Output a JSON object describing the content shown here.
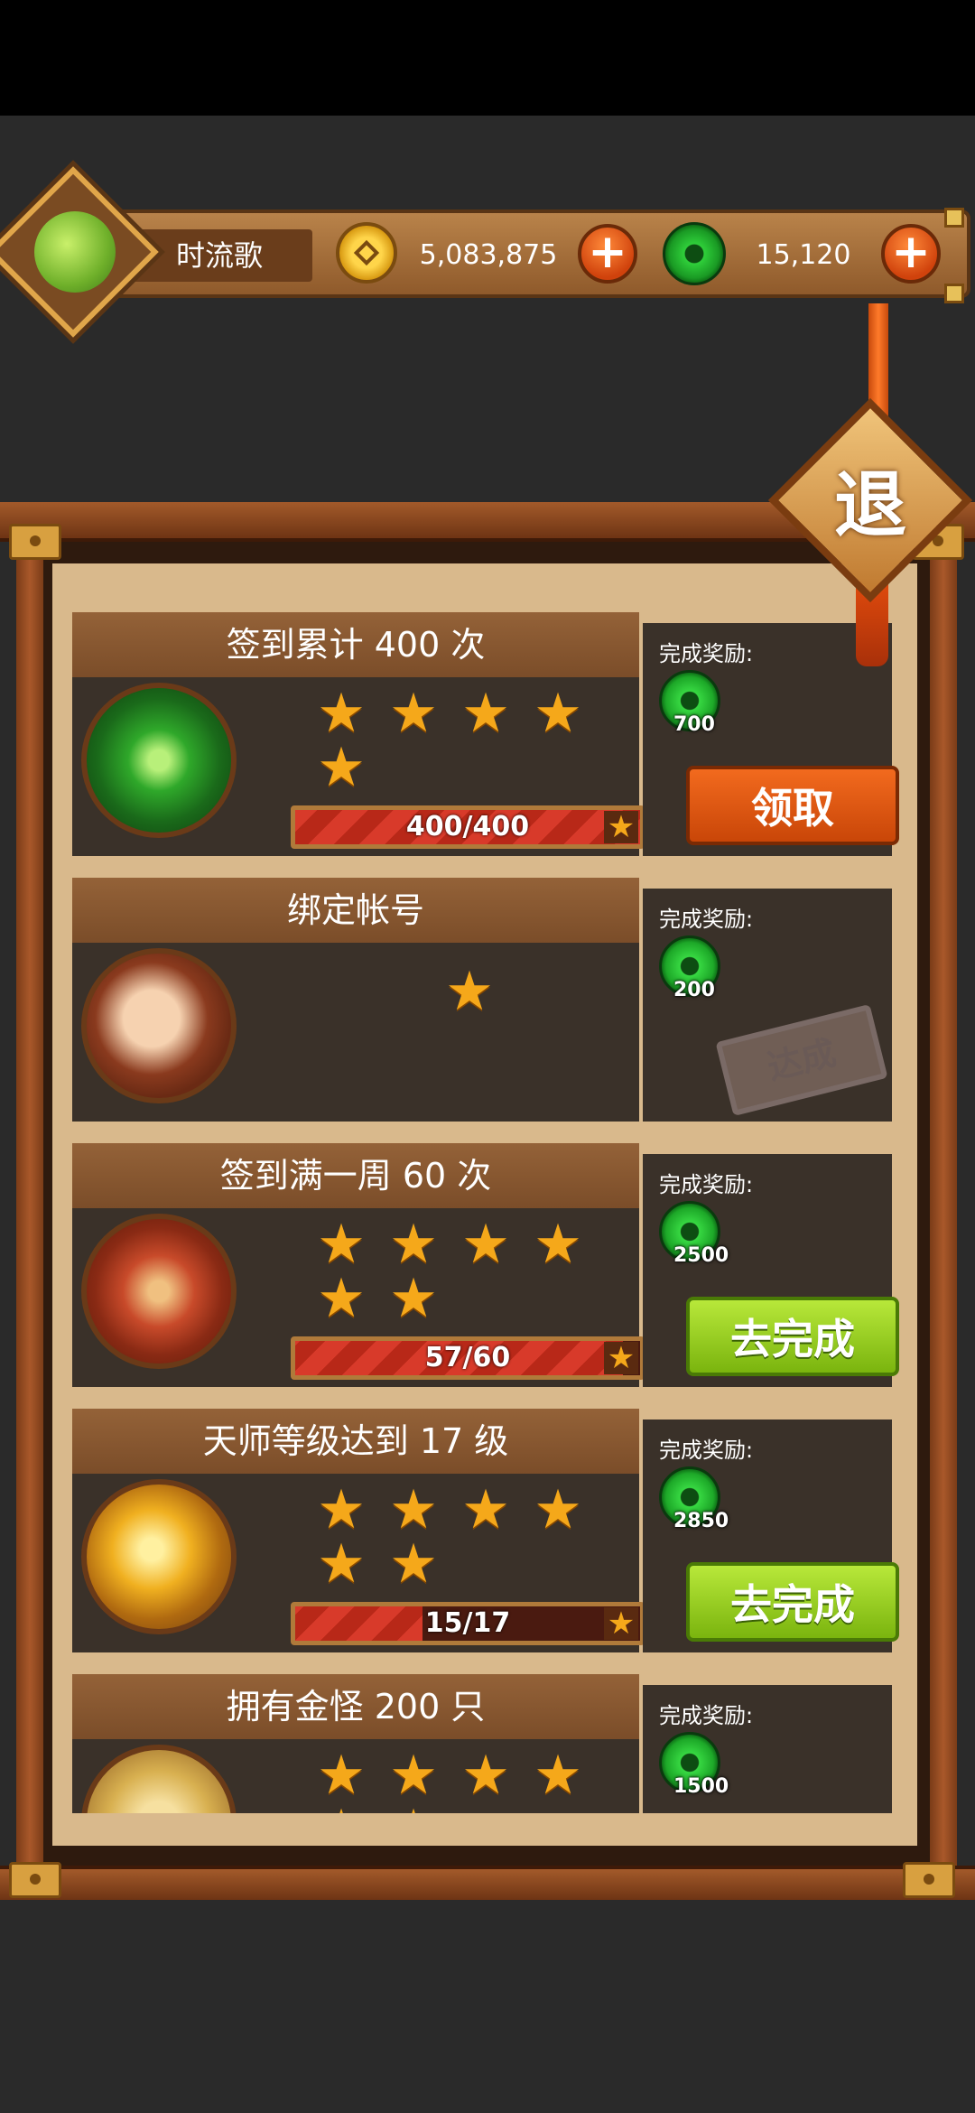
{
  "header": {
    "player_name": "时流歌",
    "coins": "5,083,875",
    "jade": "15,120",
    "plus_symbol": "+"
  },
  "exit_label": "退",
  "reward_label": "完成奖励:",
  "tasks": [
    {
      "title": "签到累计 400 次",
      "reward": "700",
      "stars": 5,
      "progress_text": "400/400",
      "progress": 1.0,
      "action": "领取",
      "state": "claim"
    },
    {
      "title": "绑定帐号",
      "reward": "200",
      "stars": 1,
      "action": "达成",
      "state": "done"
    },
    {
      "title": "签到满一周 60 次",
      "reward": "2500",
      "stars": 6,
      "progress_text": "57/60",
      "progress": 0.95,
      "action": "去完成",
      "state": "go"
    },
    {
      "title": "天师等级达到 17 级",
      "reward": "2850",
      "stars": 6,
      "progress_text": "15/17",
      "progress": 0.88,
      "action": "去完成",
      "state": "go"
    },
    {
      "title": "拥有金怪 200 只",
      "reward": "1500",
      "stars": 6,
      "state": "partial"
    }
  ],
  "colors": {
    "accent_orange": "#e85a14",
    "accent_green": "#96cc22",
    "star": "#f5a81a",
    "jade": "#2fcf3a"
  },
  "icons": {
    "coin": "coin-icon",
    "jade": "jade-icon",
    "star": "star-icon",
    "avatar": "avatar-icon"
  }
}
